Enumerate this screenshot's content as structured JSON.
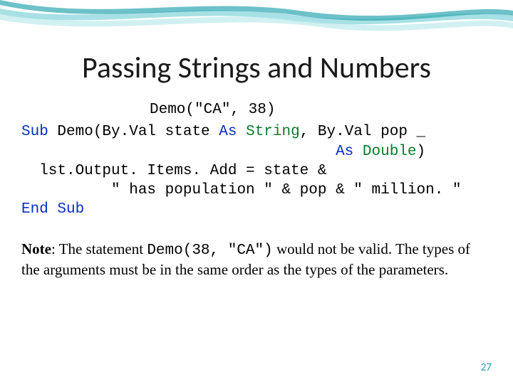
{
  "slide": {
    "title": "Passing Strings and Numbers",
    "code": {
      "call": "Demo(\"CA\", 38)",
      "l1_a": "Sub",
      "l1_b": " Demo(By.Val state ",
      "l1_c": "As",
      "l1_d": " ",
      "l1_e": "String",
      "l1_f": ", By.Val pop _",
      "l2_a": "                                   ",
      "l2_b": "As",
      "l2_c": " ",
      "l2_d": "Double",
      "l2_e": ")",
      "l3": "  lst.Output. Items. Add = state &",
      "l4": "          \" has population \" & pop & \" million. \"",
      "l5": "End Sub"
    },
    "note": {
      "label": "Note",
      "part1": ": The statement ",
      "inline_code": "Demo(38, \"CA\")",
      "part2": "  would not be valid. The types of the arguments must be in the same order as the types of the parameters."
    },
    "page_number": "27"
  }
}
